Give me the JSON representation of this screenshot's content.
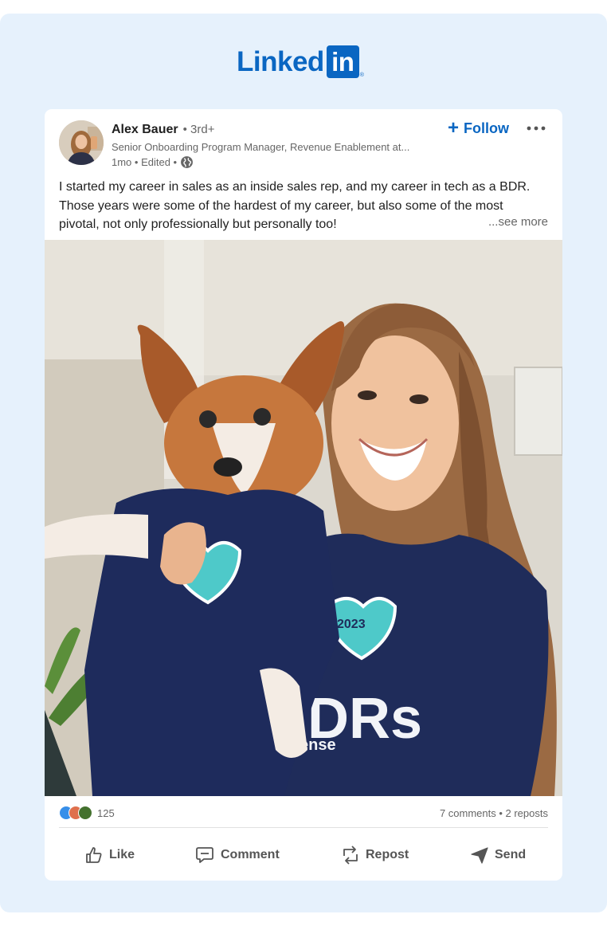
{
  "brand": {
    "logo_word": "Linked",
    "logo_box": "in",
    "reg": "®",
    "color": "#0a66c2"
  },
  "post": {
    "author": {
      "name": "Alex Bauer",
      "degree": "• 3rd+",
      "headline": "Senior Onboarding Program Manager, Revenue Enablement at...",
      "meta": "1mo • Edited •"
    },
    "follow_label": "Follow",
    "text_lines": [
      "I started my career in sales as an inside sales rep, and my career in tech as a BDR.",
      "Those years were some of the hardest of my career, but also some of the most",
      "pivotal, not only professionally but personally too!"
    ],
    "see_more": "...see more",
    "image": {
      "shirt_badge_text": "2023",
      "shirt_letters": "DRs",
      "shirt_brand": "ense"
    }
  },
  "social": {
    "reaction_count": "125",
    "comments_reposts": "7 comments • 2 reposts",
    "reaction_icons": [
      "like-icon",
      "love-icon",
      "insightful-icon"
    ]
  },
  "actions": {
    "like": "Like",
    "comment": "Comment",
    "repost": "Repost",
    "send": "Send"
  }
}
